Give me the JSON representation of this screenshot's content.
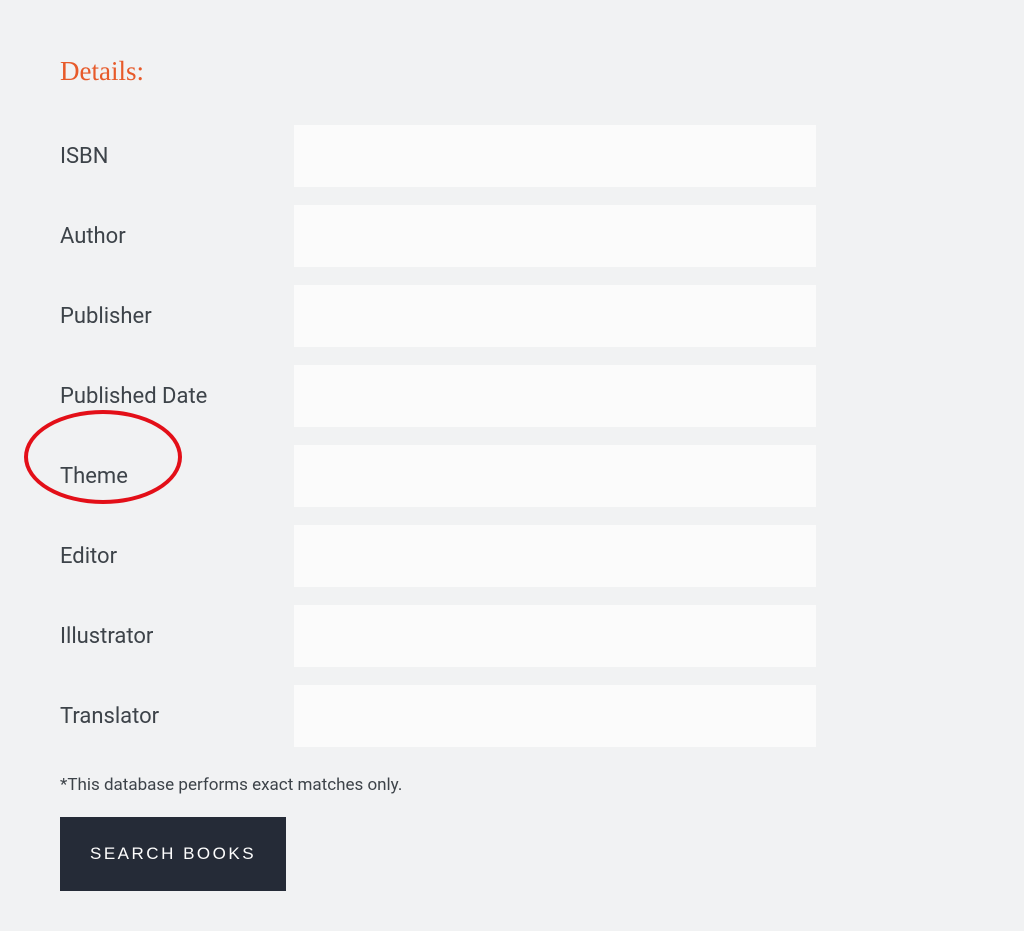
{
  "section_title": "Details:",
  "fields": {
    "isbn": {
      "label": "ISBN",
      "value": ""
    },
    "author": {
      "label": "Author",
      "value": ""
    },
    "publisher": {
      "label": "Publisher",
      "value": ""
    },
    "published_date": {
      "label": "Published Date",
      "value": ""
    },
    "theme": {
      "label": "Theme",
      "value": ""
    },
    "editor": {
      "label": "Editor",
      "value": ""
    },
    "illustrator": {
      "label": "Illustrator",
      "value": ""
    },
    "translator": {
      "label": "Translator",
      "value": ""
    }
  },
  "disclaimer": "*This database performs exact matches only.",
  "search_button_label": "SEARCH BOOKS",
  "highlighted_field": "theme"
}
